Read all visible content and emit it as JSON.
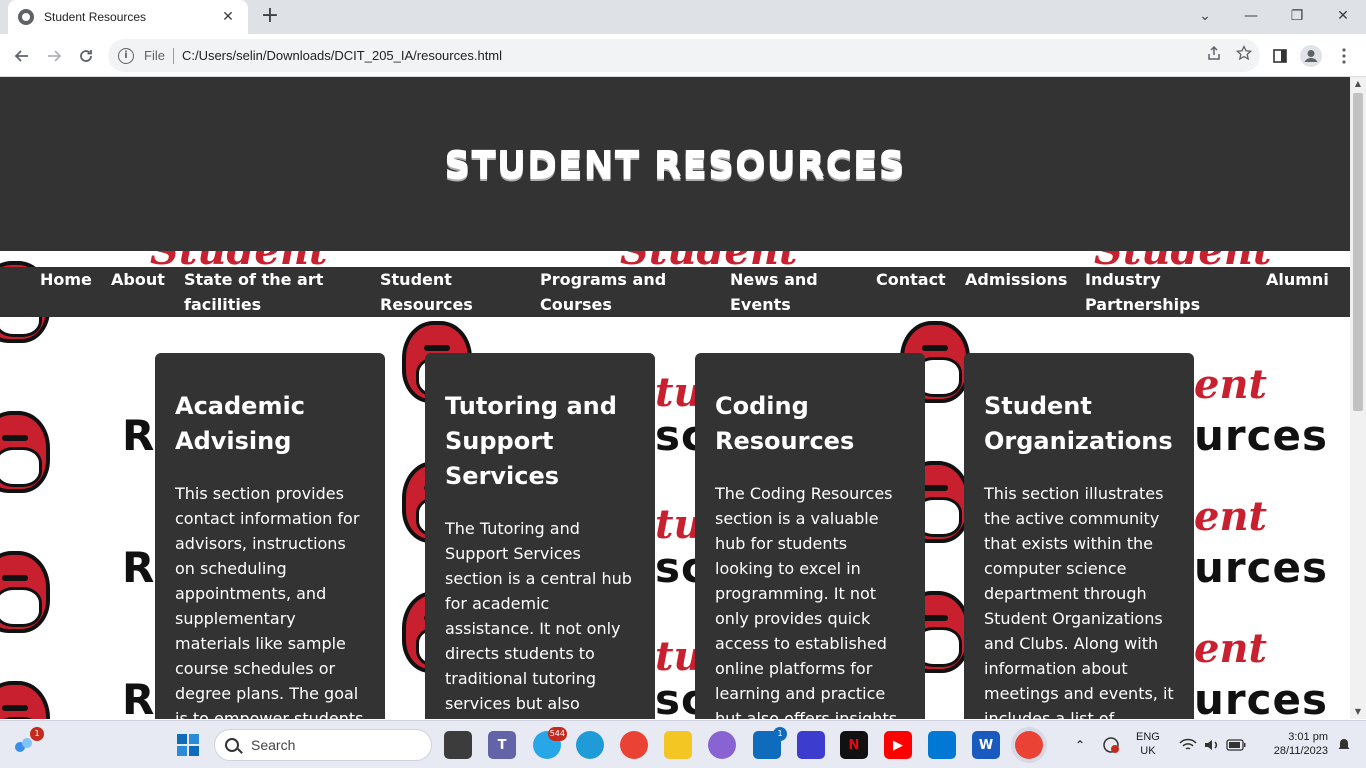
{
  "browser": {
    "tab_title": "Student Resources",
    "tab_close": "✕",
    "new_tab": "+",
    "url_scheme_label": "File",
    "url": "C:/Users/selin/Downloads/DCIT_205_IA/resources.html",
    "window_controls": {
      "minimize": "—",
      "restore": "❐",
      "close": "✕",
      "tab_search": "⌄"
    }
  },
  "page": {
    "title": "STUDENT RESOURCES",
    "nav": [
      {
        "label": "Home"
      },
      {
        "label": "About"
      },
      {
        "label": "State of the art facilities"
      },
      {
        "label": "Student Resources"
      },
      {
        "label": "Programs and Courses"
      },
      {
        "label": "News and Events"
      },
      {
        "label": "Contact"
      },
      {
        "label": "Admissions"
      },
      {
        "label": "Industry Partnerships"
      },
      {
        "label": "Alumni"
      }
    ],
    "cards": [
      {
        "title": "Academic Advising",
        "body": "This section provides contact information for advisors, instructions on scheduling appointments, and supplementary materials like sample course schedules or degree plans. The goal is to empower students"
      },
      {
        "title": "Tutoring and Support Services",
        "body": "The Tutoring and Support Services section is a central hub for academic assistance. It not only directs students to traditional tutoring services but also"
      },
      {
        "title": "Coding Resources",
        "body": "The Coding Resources section is a valuable hub for students looking to excel in programming. It not only provides quick access to established online platforms for learning and practice but also offers insights"
      },
      {
        "title": "Student Organizations",
        "body": "This section illustrates the active community that exists within the computer science department through Student Organizations and Clubs. Along with information about meetings and events, it includes a list of"
      }
    ],
    "background": {
      "script_word": "Student",
      "block_word": "Resources"
    }
  },
  "taskbar": {
    "search_placeholder": "Search",
    "widgets_badge": "1",
    "telegram_badge": "544",
    "mail_badge": "1",
    "language_line1": "ENG",
    "language_line2": "UK",
    "time": "3:01 pm",
    "date": "28/11/2023"
  },
  "colors": {
    "header_bg": "#333333",
    "accent_red": "#c8202f",
    "chrome_bg": "#dee1e6"
  }
}
